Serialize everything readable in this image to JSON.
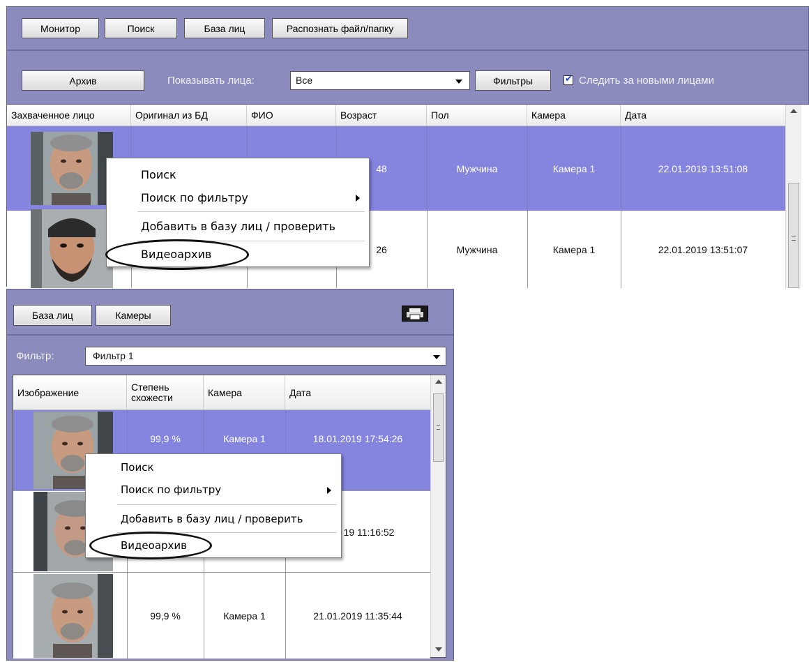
{
  "colors": {
    "panel": "#8b8cbd",
    "panel_border": "#606090",
    "selected_row": "#8585e0",
    "row_bg": "#ffffff"
  },
  "top": {
    "nav_buttons": [
      "Монитор",
      "Поиск",
      "База лиц",
      "Распознать файл/папку"
    ],
    "archive_button": "Архив",
    "show_faces_label": "Показывать лица:",
    "show_faces_value": "Все",
    "filters_button": "Фильтры",
    "follow_checkbox_label": "Следить за новыми лицами",
    "follow_checked": true,
    "columns": [
      "Захваченное лицо",
      "Оригинал из БД",
      "ФИО",
      "Возраст",
      "Пол",
      "Камера",
      "Дата"
    ],
    "rows": [
      {
        "age": "48",
        "gender": "Мужчина",
        "camera": "Камера 1",
        "date": "22.01.2019 13:51:08",
        "selected": true,
        "face": "face-icon"
      },
      {
        "age": "26",
        "gender": "Мужчина",
        "camera": "Камера 1",
        "date": "22.01.2019 13:51:07",
        "selected": false,
        "face": "face-icon"
      }
    ],
    "context_menu": [
      "Поиск",
      "Поиск по фильтру",
      "Добавить в базу лиц / проверить",
      "Видеоархив"
    ]
  },
  "bottom": {
    "tabs": [
      "База лиц",
      "Камеры"
    ],
    "print_icon": "print-icon",
    "filter_label": "Фильтр:",
    "filter_value": "Фильтр 1",
    "columns": [
      "Изображение",
      "Степень схожести",
      "Камера",
      "Дата"
    ],
    "rows": [
      {
        "similarity": "99,9 %",
        "camera": "Камера 1",
        "date": "18.01.2019 17:54:26",
        "selected": true,
        "face": "face-icon"
      },
      {
        "similarity": "",
        "camera": "",
        "date": "19 11:16:52",
        "selected": false,
        "face": "face-icon"
      },
      {
        "similarity": "99,9 %",
        "camera": "Камера 1",
        "date": "21.01.2019 11:35:44",
        "selected": false,
        "face": "face-icon"
      }
    ],
    "context_menu": [
      "Поиск",
      "Поиск по фильтру",
      "Добавить в базу лиц / проверить",
      "Видеоархив"
    ]
  }
}
